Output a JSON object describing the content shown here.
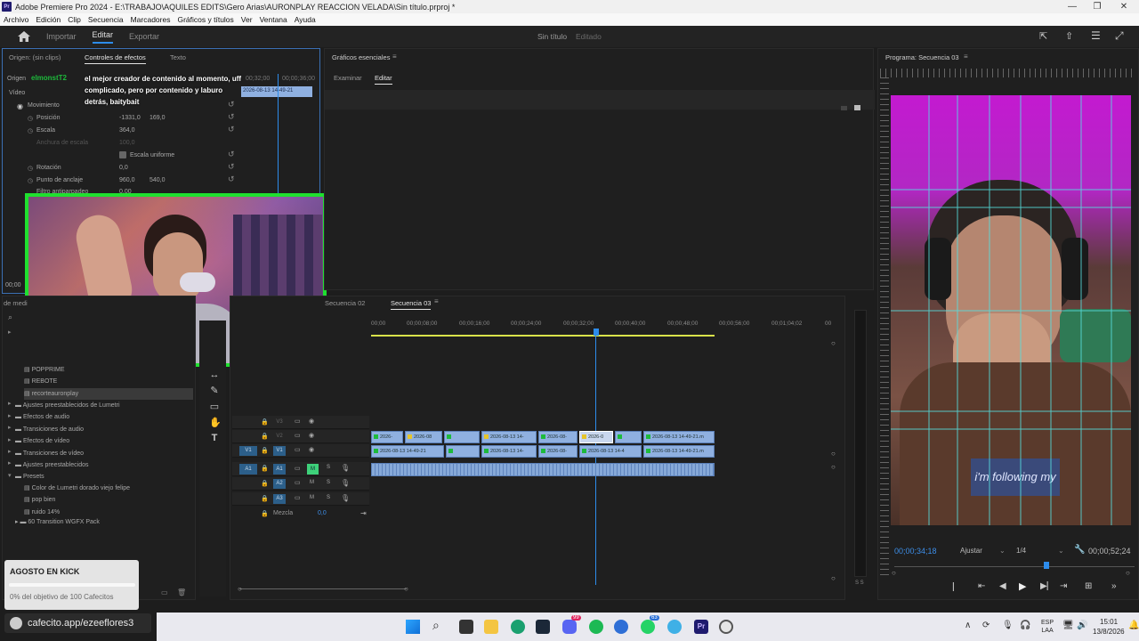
{
  "window": {
    "title": "Adobe Premiere Pro 2024 - E:\\TRABAJO\\AQUILES EDITS\\Gero Arias\\AURONPLAY REACCION VELADA\\Sin título.prproj *"
  },
  "menu": [
    "Archivo",
    "Edición",
    "Clip",
    "Secuencia",
    "Marcadores",
    "Gráficos y títulos",
    "Ver",
    "Ventana",
    "Ayuda"
  ],
  "header": {
    "tabs": [
      "Importar",
      "Editar",
      "Exportar"
    ],
    "active": "Editar",
    "project_title": "Sin título",
    "status": "Editado"
  },
  "effects_panel": {
    "tabs": [
      "Origen: (sin clips)",
      "Controles de efectos",
      "Texto"
    ],
    "origin_label": "Origen",
    "video_label": "Vídeo",
    "timecode": "00;32;00",
    "timecode2": "00;00;36;00",
    "clip_label": "2026-08-13 14-49-21",
    "chat_user": "elmonstT2",
    "chat_text": "el mejor creador de contenido al momento, uff complicado, pero por contenido y laburo detrás, baitybait",
    "group": "Movimiento",
    "props": [
      {
        "name": "Posición",
        "v1": "-1331,0",
        "v2": "169,0"
      },
      {
        "name": "Escala",
        "v1": "364,0",
        "v2": ""
      },
      {
        "name": "Anchura de escala",
        "v1": "100,0",
        "v2": ""
      },
      {
        "name": "Escala uniforme",
        "v1": "",
        "v2": ""
      },
      {
        "name": "Rotación",
        "v1": "0,0",
        "v2": ""
      },
      {
        "name": "Punto de anclaje",
        "v1": "960,0",
        "v2": "540,0"
      },
      {
        "name": "Filtro antiparpadeo",
        "v1": "0,00",
        "v2": ""
      }
    ],
    "bottom_timecode": "00;00"
  },
  "graphics_panel": {
    "title": "Gráficos esenciales",
    "tabs": [
      "Examinar",
      "Editar"
    ],
    "active": "Editar"
  },
  "program_panel": {
    "title": "Programa: Secuencia 03",
    "timecode_left": "00;00;34;18",
    "fit": "Ajustar",
    "resolution": "1/4",
    "timecode_right": "00;00;52;24",
    "caption": "i'm following my"
  },
  "project_panel": {
    "label": "de medi",
    "items": [
      "POPPRIME",
      "REBOTE",
      "recorteauronplay",
      "Ajustes preestablecidos de Lumetri",
      "Efectos de audio",
      "Transiciones de audio",
      "Efectos de vídeo",
      "Transiciones de vídeo",
      "Ajustes preestablecidos",
      "Presets",
      "Color de Lumetri dorado viejo felipe",
      "pop bien",
      "ruido 14%",
      "60 Transition WGFX Pack"
    ]
  },
  "timeline": {
    "tabs": [
      "Secuencia 02",
      "Secuencia 03"
    ],
    "active": "Secuencia 03",
    "ruler": [
      "00;00",
      "00;00;08;00",
      "00;00;16;00",
      "00;00;24;00",
      "00;00;32;00",
      "00;00;40;00",
      "00;00;48;00",
      "00;00;56;00",
      "00;01;04;02",
      "00"
    ],
    "tracks": [
      {
        "src": "",
        "name": "V3"
      },
      {
        "src": "",
        "name": "V2"
      },
      {
        "src": "V1",
        "name": "V1"
      },
      {
        "src": "A1",
        "name": "A1"
      },
      {
        "src": "",
        "name": "A2"
      },
      {
        "src": "",
        "name": "A3"
      }
    ],
    "mix_label": "Mezcla",
    "mix_value": "0,0",
    "v2_clips": [
      "2026-",
      "2026-08",
      "",
      "2026-08-13 14-",
      "2026-08-",
      "2026-0",
      "",
      "2026-08-13 14-49-21.m"
    ],
    "v1_clips": [
      "2026-08-13 14-49-21",
      "",
      "2026-08-13 14-",
      "2026-08-",
      "2026-08-13 14-4",
      "2026-08-13 14-49-21.m"
    ]
  },
  "overlay": {
    "title": "AGOSTO EN KICK",
    "progress_text": "0% del objetivo de 100 Cafecitos",
    "progress": 0,
    "url": "cafecito.app/ezeeflores3"
  },
  "taskbar": {
    "lang": "ESP",
    "lang2": "LAA",
    "time": "15:01",
    "date": "13/8/2026",
    "badge1": "99",
    "badge2": "63"
  },
  "colors": {
    "accent": "#2d8ceb",
    "green_frame": "#1fe02f",
    "magenta": "#c31ad0"
  }
}
